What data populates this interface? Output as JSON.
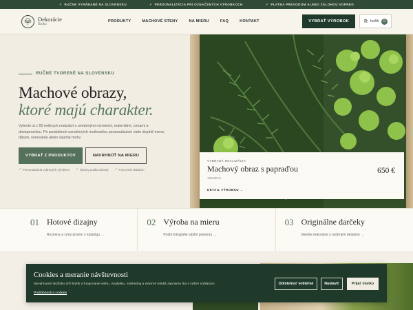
{
  "topbar": {
    "items": [
      "RUČNE VYRÁBANÉ NA SLOVENSKU",
      "PERSONALIZÁCIA PRI OZNAČENÝCH VÝROBKOCH",
      "PLATBA PREVODOM ALEBO ZÁLOHOU VOPRED"
    ]
  },
  "header": {
    "logo_name": "Dekorácie",
    "logo_sub": "Radka",
    "nav": [
      "PRODUKTY",
      "MACHOVÉ STENY",
      "NA MIERU",
      "FAQ",
      "KONTAKT"
    ],
    "choose_button": "VYBRAŤ VÝROBOK",
    "cart_label": "košík",
    "cart_count": "0"
  },
  "hero": {
    "eyebrow": "RUČNE TVORENÉ NA SLOVENSKU",
    "title_line1": "Machové obrazy,",
    "title_line2": "ktoré majú charakter.",
    "lead": "Vyberte si z 55 reálnych realizácií s uvedenými rozmermi, materiálmi, cenami a dostupnosťou. Pri produktoch označených možnosťou personalizácie viete doplniť meno, dátum, venovanie alebo vlastný motív.",
    "cta_primary": "VYBRAŤ Z PRODUKTOV",
    "cta_secondary": "NAVRHNÚŤ NA MIERU",
    "checks": [
      "Personalizácia vybraných výrobkov",
      "Úpravy podľa dohody",
      "Foto jemb skladom"
    ]
  },
  "featured": {
    "kicker": "VYBRANÁ REALIZÁCIA",
    "title": "Machový obraz s papraďou",
    "size": "120x80cm",
    "price": "650 €",
    "detail": "DETAIL VÝROBKU →"
  },
  "features": [
    {
      "num": "01",
      "title": "Hotové dizajny",
      "sub": "Rozmery a ceny priamo v katalógu →"
    },
    {
      "num": "02",
      "title": "Výroba na mieru",
      "sub": "Podľa fotografie vášho priestoru →"
    },
    {
      "num": "03",
      "title": "Originálne darčeky",
      "sub": "Menšie dekorácie s osobným detailom →"
    }
  ],
  "cookie": {
    "title": "Cookies a meranie návštevnosti",
    "desc": "Nevyhnutné úložisko drží košík a fungovanie webu. Analytiku, marketing a externé médiá zapneme iba s vaším súhlasom.",
    "link": "Podrobnosti o cookies",
    "reject": "Odmietnuť voliteľné",
    "settings": "Nastaviť",
    "accept": "Prijať všetko"
  },
  "colors": {
    "dark_green": "#1f3a2a",
    "sage": "#55705b",
    "cream": "#f3efe6"
  }
}
